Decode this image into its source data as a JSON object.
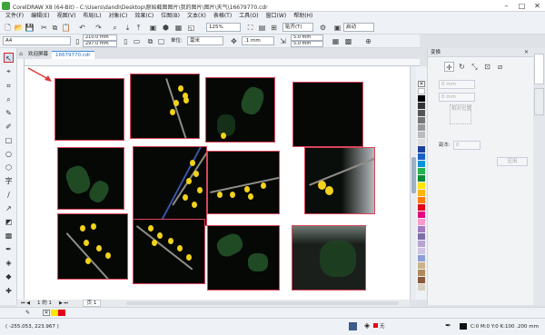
{
  "window": {
    "title": "CorelDRAW X8 (64-Bit) - C:\\Users\\dandi\\Desktop\\原始截图图片\\我的图片\\图片\\天气\\16679770.cdr"
  },
  "menu": [
    "文件(F)",
    "编辑(E)",
    "视图(V)",
    "布局(L)",
    "对象(C)",
    "效果(C)",
    "位图(B)",
    "文本(X)",
    "表格(T)",
    "工具(O)",
    "窗口(W)",
    "帮助(H)"
  ],
  "toolbar": {
    "zoom": "125%",
    "snap_label": "贴齐(T)",
    "launch_label": "启动"
  },
  "propbar": {
    "paper": "A4",
    "width": "210.0 mm",
    "height": "297.0 mm",
    "unit_label": "单位:",
    "unit": "毫米",
    "nudge": ".1 mm",
    "dup_x": "5.0 mm",
    "dup_y": "5.0 mm"
  },
  "tabs": {
    "welcome": "欢迎屏幕",
    "doc": "16679770.cdr"
  },
  "docker": {
    "title": "变换",
    "field1": "0 mm",
    "field2": "0 mm",
    "check_label": "相对位置",
    "copies_label": "副本:",
    "copies": "0",
    "apply_label": "应用"
  },
  "pages": {
    "counter": "1 的 1",
    "page_tab": "页 1"
  },
  "status": {
    "coords": "( -255.053, 223.967 )",
    "fill_none": "无",
    "color_info": "C:0 M:0 Y:0 K:100  .200 mm"
  },
  "colors": {
    "accent": "#3c8ad8",
    "photo_border": "#d9455a"
  },
  "icons": [
    "pick-tool-icon",
    "shape-tool-icon",
    "crop-tool-icon",
    "zoom-tool-icon",
    "freehand-tool-icon",
    "rectangle-tool-icon",
    "ellipse-tool-icon",
    "polygon-tool-icon",
    "text-tool-icon",
    "line-tool-icon",
    "fill-tool-icon",
    "eyedropper-tool-icon"
  ]
}
